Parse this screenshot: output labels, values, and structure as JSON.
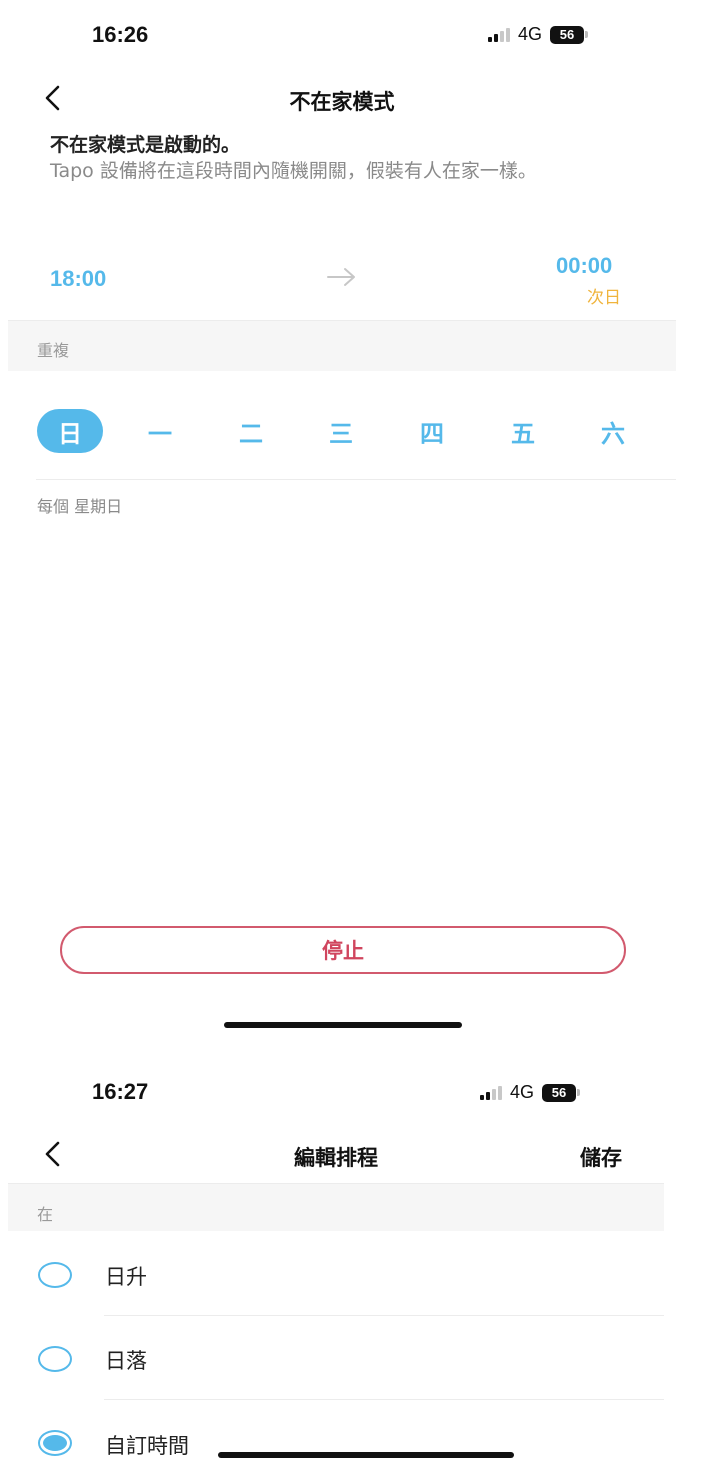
{
  "screen1": {
    "status_bar": {
      "time": "16:26",
      "network": "4G",
      "battery": "56"
    },
    "nav": {
      "title": "不在家模式"
    },
    "status_text": "不在家模式是啟動的。",
    "description": "Tapo 設備將在這段時間內隨機開關，假裝有人在家一樣。",
    "start_time": "18:00",
    "end_time": "00:00",
    "end_note": "次日",
    "repeat": {
      "label": "重複",
      "days": [
        "日",
        "一",
        "二",
        "三",
        "四",
        "五",
        "六"
      ],
      "selected_index": 0,
      "summary": "每個 星期日"
    },
    "stop_label": "停止"
  },
  "screen2": {
    "status_bar": {
      "time": "16:27",
      "network": "4G",
      "battery": "56"
    },
    "nav": {
      "title": "編輯排程",
      "save_label": "儲存"
    },
    "section_label": "在",
    "options": [
      {
        "label": "日升",
        "checked": false
      },
      {
        "label": "日落",
        "checked": false
      },
      {
        "label": "自訂時間",
        "checked": true
      }
    ]
  },
  "colors": {
    "accent": "#55b9ea",
    "stop": "#d0455e",
    "next_day": "#f0b43c"
  }
}
